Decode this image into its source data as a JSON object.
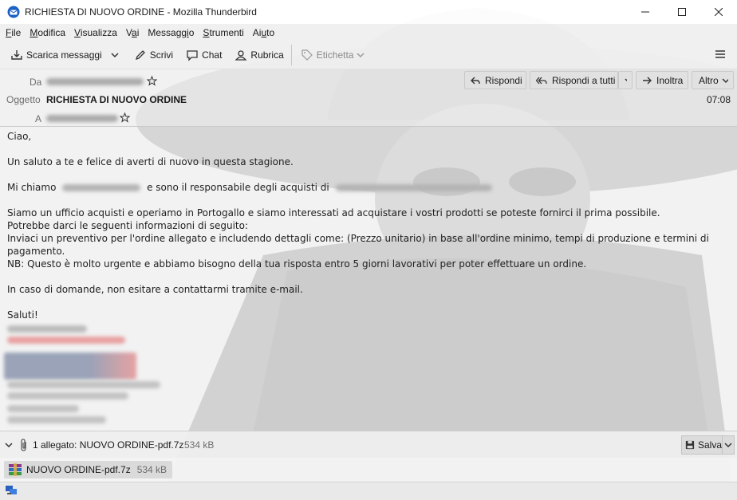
{
  "window": {
    "title": "RICHIESTA DI NUOVO ORDINE - Mozilla Thunderbird"
  },
  "menu": [
    "File",
    "Modifica",
    "Visualizza",
    "Vai",
    "Messaggio",
    "Strumenti",
    "Aiuto"
  ],
  "menu_underline_index": [
    0,
    0,
    0,
    1,
    7,
    0,
    2
  ],
  "toolbar": {
    "get_messages": "Scarica messaggi",
    "write": "Scrivi",
    "chat": "Chat",
    "address_book": "Rubrica",
    "tag": "Etichetta"
  },
  "header": {
    "from_label": "Da",
    "subject_label": "Oggetto",
    "subject": "RICHIESTA DI NUOVO ORDINE",
    "to_label": "A",
    "time": "07:08",
    "reply": "Rispondi",
    "reply_all": "Rispondi a tutti",
    "forward": "Inoltra",
    "more": "Altro"
  },
  "body": {
    "greeting": "Ciao,",
    "p1": "Un saluto a te e felice di averti di nuovo in questa stagione.",
    "p2a": "Mi chiamo",
    "p2b": "e sono il responsabile degli acquisti di",
    "p3l1": "Siamo un ufficio acquisti e operiamo in Portogallo e siamo interessati ad acquistare i vostri prodotti se poteste fornirci il prima possibile.",
    "p3l2": "Potrebbe darci le seguenti informazioni di seguito:",
    "p3l3": "Inviaci un preventivo per l'ordine allegato e includendo dettagli come: (Prezzo unitario) in base all'ordine minimo, tempi di produzione e termini di pagamento.",
    "p3l4": "NB: Questo è molto urgente e abbiamo bisogno della tua risposta entro 5 giorni lavorativi per poter effettuare un ordine.",
    "p4": "In caso di domande, non esitare a contattarmi tramite e-mail.",
    "closing": "Saluti!"
  },
  "attachments": {
    "summary": "1 allegato: NUOVO ORDINE-pdf.7z",
    "summary_size": "534 kB",
    "save": "Salva",
    "items": [
      {
        "name": "NUOVO ORDINE-pdf.7z",
        "size": "534 kB"
      }
    ]
  },
  "colors": {
    "accent": "#0a84ff",
    "link_blue": "#1f5fbf",
    "archive_icon": "#8b3a8f"
  }
}
